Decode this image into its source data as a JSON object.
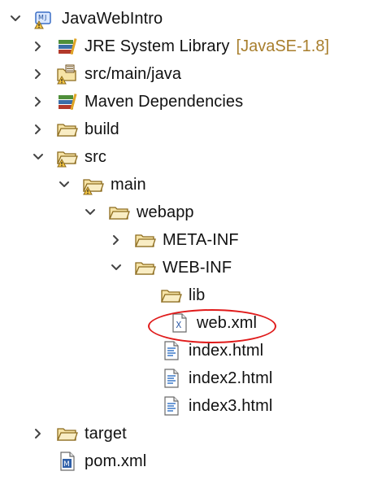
{
  "project": {
    "name": "JavaWebIntro"
  },
  "tree": {
    "jre": {
      "label": "JRE System Library",
      "suffix": "[JavaSE-1.8]"
    },
    "src_main_java": {
      "label": "src/main/java"
    },
    "maven_deps": {
      "label": "Maven Dependencies"
    },
    "build": {
      "label": "build"
    },
    "src": {
      "label": "src"
    },
    "main": {
      "label": "main"
    },
    "webapp": {
      "label": "webapp"
    },
    "meta_inf": {
      "label": "META-INF"
    },
    "web_inf": {
      "label": "WEB-INF"
    },
    "lib": {
      "label": "lib"
    },
    "web_xml": {
      "label": "web.xml"
    },
    "index_html": {
      "label": "index.html"
    },
    "index2_html": {
      "label": "index2.html"
    },
    "index3_html": {
      "label": "index3.html"
    },
    "target": {
      "label": "target"
    },
    "pom_xml": {
      "label": "pom.xml"
    }
  },
  "icons": {
    "project": "maven-java-project-warning-icon",
    "library": "library-books-icon",
    "package_folder": "source-folder-warning-icon",
    "folder": "folder-open-icon",
    "folder_warning": "folder-warning-icon",
    "xml_file": "xml-file-icon",
    "html_file": "html-file-icon",
    "maven_file": "maven-pom-file-icon"
  },
  "colors": {
    "suffix": "#a87e2c",
    "highlight": "#e01b1b",
    "folder_fill": "#f6e3a6",
    "folder_stroke": "#8c6b1d"
  }
}
